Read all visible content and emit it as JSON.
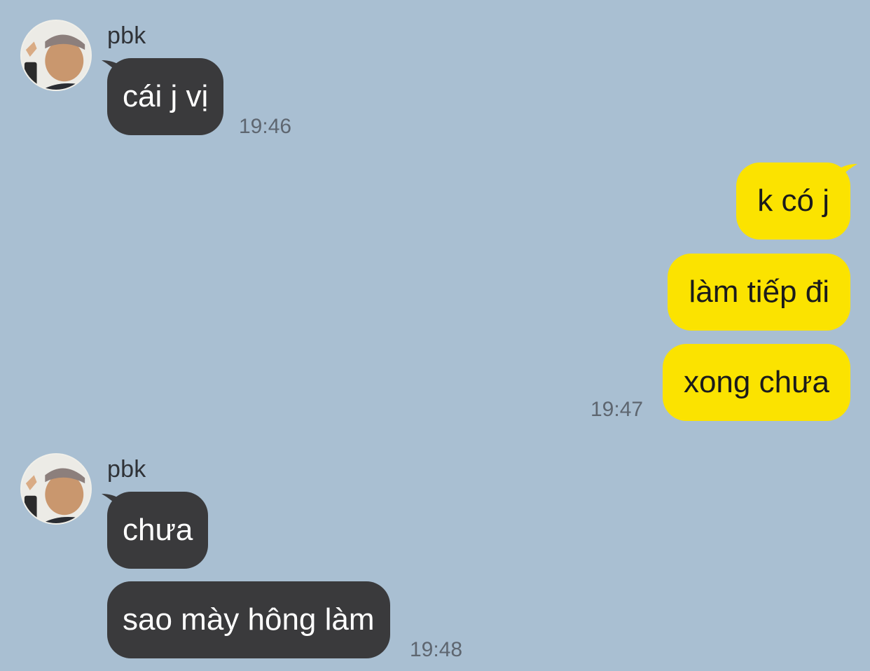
{
  "chat": {
    "groups": [
      {
        "sender": "pbk",
        "avatar_icon": "profile-photo-icon",
        "messages": [
          "cái j vị"
        ],
        "time": "19:46"
      },
      {
        "sender": "",
        "messages": [
          "k có j",
          "làm tiếp đi",
          "xong chưa"
        ],
        "time": "19:47"
      },
      {
        "sender": "pbk",
        "avatar_icon": "profile-photo-icon",
        "messages": [
          "chưa",
          "sao mày hông làm"
        ],
        "time": "19:48"
      }
    ]
  },
  "colors": {
    "background": "#a9bfd2",
    "incoming_bubble": "#3a3a3c",
    "outgoing_bubble": "#fbe300"
  }
}
